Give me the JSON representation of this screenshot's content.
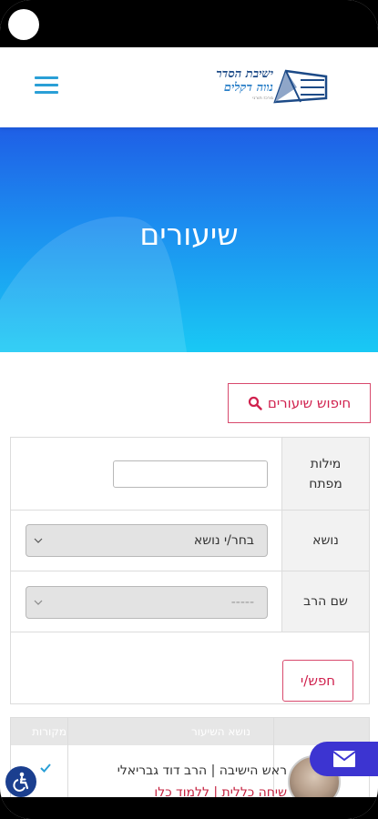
{
  "header": {
    "logo": {
      "line1": "ישיבת הסדר",
      "line2": "נווה דקלים",
      "line3": "מרכז תורני"
    },
    "menu_icon": "hamburger-icon"
  },
  "hero": {
    "title": "שיעורים"
  },
  "search": {
    "toggle_label": "חיפוש שיעורים",
    "icon": "search-icon"
  },
  "form": {
    "keywords_label": "מילות מפתח",
    "keywords_value": "",
    "topic_label": "נושא",
    "topic_selected": "בחר/י נושא",
    "rabbi_label": "שם הרב",
    "rabbi_selected": "-----",
    "submit_label": "חפש/י"
  },
  "results": {
    "columns": [
      "",
      "נושא השיעור",
      "מקורות"
    ],
    "row1": {
      "speaker": "ראש הישיבה | הרב דוד גבריאלי",
      "title": "שיחה כללית | ללמוד כלו"
    }
  },
  "floating": {
    "accessibility_icon": "accessibility-icon",
    "mail_icon": "mail-icon"
  },
  "colors": {
    "accent": "#d0214e",
    "brand_blue": "#1c4a87",
    "hero_top": "#1f5fe6",
    "hero_bottom": "#19c9f4",
    "mail_button": "#3c34d1"
  }
}
